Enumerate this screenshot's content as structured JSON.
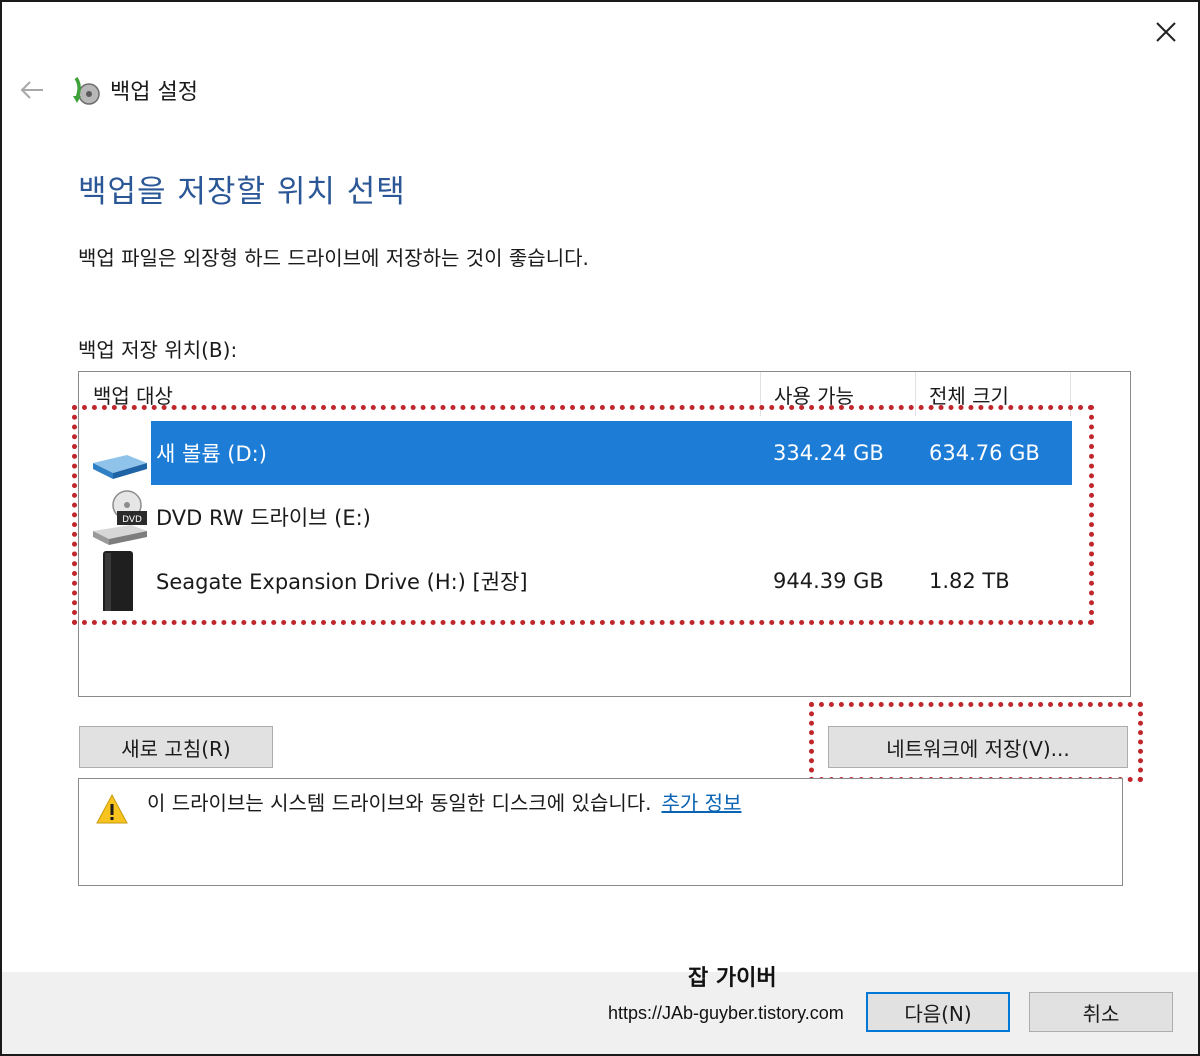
{
  "window": {
    "title": "백업 설정",
    "close_icon": "close-icon",
    "back_icon": "back-arrow-icon",
    "app_icon": "backup-icon"
  },
  "heading": "백업을 저장할 위치 선택",
  "description": "백업 파일은 외장형 하드 드라이브에 저장하는 것이 좋습니다.",
  "list_label": "백업 저장 위치(B):",
  "columns": [
    "백업 대상",
    "사용 가능",
    "전체 크기"
  ],
  "drives": [
    {
      "name": "새 볼륨 (D:)",
      "free": "334.24 GB",
      "total": "634.76 GB",
      "icon": "volume-drive-icon",
      "selected": true
    },
    {
      "name": "DVD RW 드라이브 (E:)",
      "free": "",
      "total": "",
      "icon": "dvd-drive-icon",
      "selected": false
    },
    {
      "name": "Seagate Expansion Drive (H:) [권장]",
      "free": "944.39 GB",
      "total": "1.82 TB",
      "icon": "external-drive-icon",
      "selected": false
    }
  ],
  "buttons": {
    "refresh": "새로 고침(R)",
    "network": "네트워크에 저장(V)...",
    "next": "다음(N)",
    "cancel": "취소"
  },
  "warning": {
    "icon": "warning-icon",
    "text": "이 드라이브는 시스템 드라이브와 동일한 디스크에 있습니다.",
    "link": "추가 정보"
  },
  "watermark": {
    "title": "잡 가이버",
    "url": "https://JAb-guyber.tistory.com"
  },
  "colors": {
    "accent": "#1c7cd6",
    "heading": "#2b5797",
    "highlight_dots": "#c0272d",
    "link": "#0a64b4"
  }
}
